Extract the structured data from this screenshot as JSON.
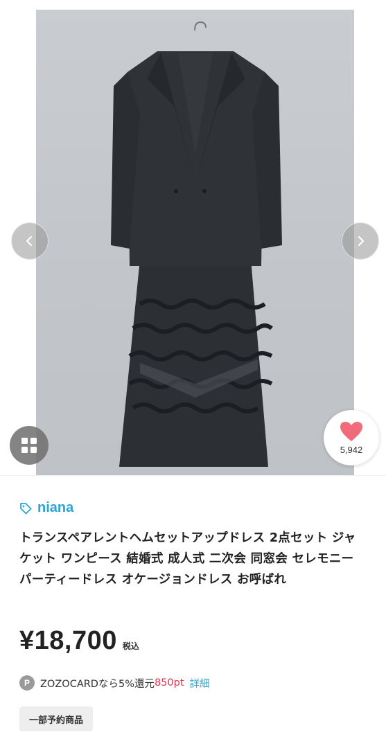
{
  "hero": {
    "image_alt": "ジャケットとフリル付きワンピースのセットアップドレス"
  },
  "favorite": {
    "count": "5,942",
    "icon": "heart-icon",
    "color": "#f26b7a"
  },
  "brand": {
    "name": "niana",
    "icon": "tag-icon",
    "color": "#2ca3d6"
  },
  "product": {
    "title": "トランスペアレントヘムセットアップドレス 2点セット ジャケット ワンピース 結婚式 成人式 二次会 同窓会 セレモニー パーティードレス オケージョンドレス お呼ばれ",
    "price": "¥18,700",
    "tax_label": "税込"
  },
  "zozocard": {
    "badge": "P",
    "text": "ZOZOCARDなら5%還元",
    "points": "850pt",
    "detail_label": "詳細",
    "points_color": "#e0344f"
  },
  "tags": {
    "preorder": "一部予約商品"
  }
}
